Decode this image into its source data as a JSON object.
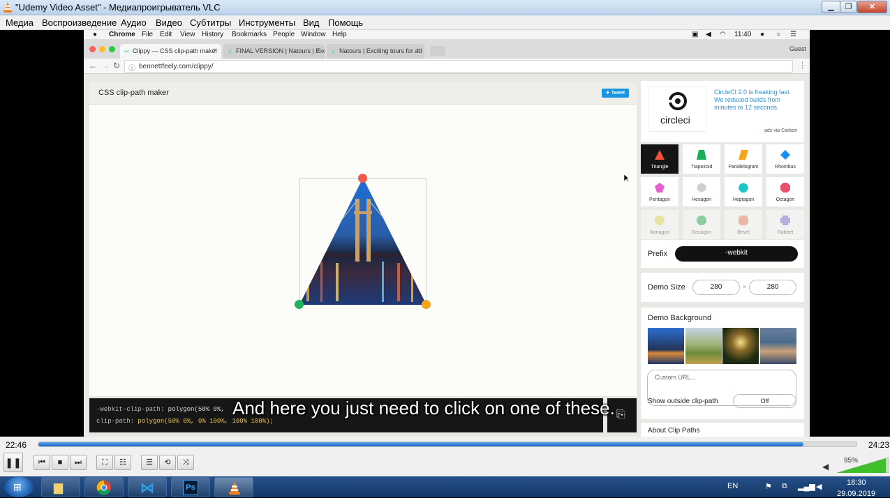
{
  "vlc": {
    "title": "\"Udemy Video Asset\" - Медиапроигрыватель VLC",
    "menu": [
      "Медиа",
      "Воспроизведение",
      "Аудио",
      "Видео",
      "Субтитры",
      "Инструменты",
      "Вид",
      "Помощь"
    ],
    "time_current": "22:46",
    "time_total": "24:23",
    "progress": 0.935,
    "volume_label": "95%",
    "subtitle": "And here you just need to click on one of these."
  },
  "mac_menu": {
    "app": "Chrome",
    "items": [
      "File",
      "Edit",
      "View",
      "History",
      "Bookmarks",
      "People",
      "Window",
      "Help"
    ],
    "clock": "11:40"
  },
  "chrome": {
    "tabs": [
      {
        "label": "Clippy — CSS clip-path maker"
      },
      {
        "label": "FINAL VERSION | Natours | Exc"
      },
      {
        "label": "Natours | Exciting tours for ad"
      }
    ],
    "profile": "Guest",
    "url": "bennettfeely.com/clippy/"
  },
  "page": {
    "title": "CSS clip-path maker",
    "tweet": "Tweet",
    "code_line1_prop": "-webkit-clip-path:",
    "code_line1_val": "polygon(50% 0%,",
    "code_line2_prop": "clip-path:",
    "code_line2_val": "polygon(50% 0%, 0% 100%, 100% 100%);"
  },
  "ad": {
    "brand": "circleci",
    "text": "CircleCI 2.0 is freaking fast. We reduced builds from minutes to 12 seconds.",
    "via": "ads via Carbon"
  },
  "shapes": [
    {
      "label": "Triangle",
      "color": "#f0523a"
    },
    {
      "label": "Trapezoid",
      "color": "#1aae5c"
    },
    {
      "label": "Parallelogram",
      "color": "#f6a61b"
    },
    {
      "label": "Rhombus",
      "color": "#1a8ef0"
    },
    {
      "label": "Pentagon",
      "color": "#e65fd1"
    },
    {
      "label": "Hexagon",
      "color": "#cfcfcf"
    },
    {
      "label": "Heptagon",
      "color": "#1ac7c7"
    },
    {
      "label": "Octagon",
      "color": "#ea4f6c"
    },
    {
      "label": "Nonagon",
      "color": "#e9e15a"
    },
    {
      "label": "Decagon",
      "color": "#1aae4a"
    },
    {
      "label": "Bevel",
      "color": "#f07d5c"
    },
    {
      "label": "Rabbet",
      "color": "#7d6ad8"
    }
  ],
  "settings": {
    "prefix_label": "Prefix",
    "prefix_value": "-webkit",
    "size_label": "Demo Size",
    "size_w": "280",
    "size_x": "×",
    "size_h": "280",
    "bg_label": "Demo Background",
    "custom_url_placeholder": "Custom URL...",
    "outside_label": "Show outside clip-path",
    "outside_value": "Off",
    "about_label": "About Clip Paths"
  },
  "taskbar": {
    "lang": "EN",
    "time": "18:30",
    "date": "29.09.2019"
  }
}
